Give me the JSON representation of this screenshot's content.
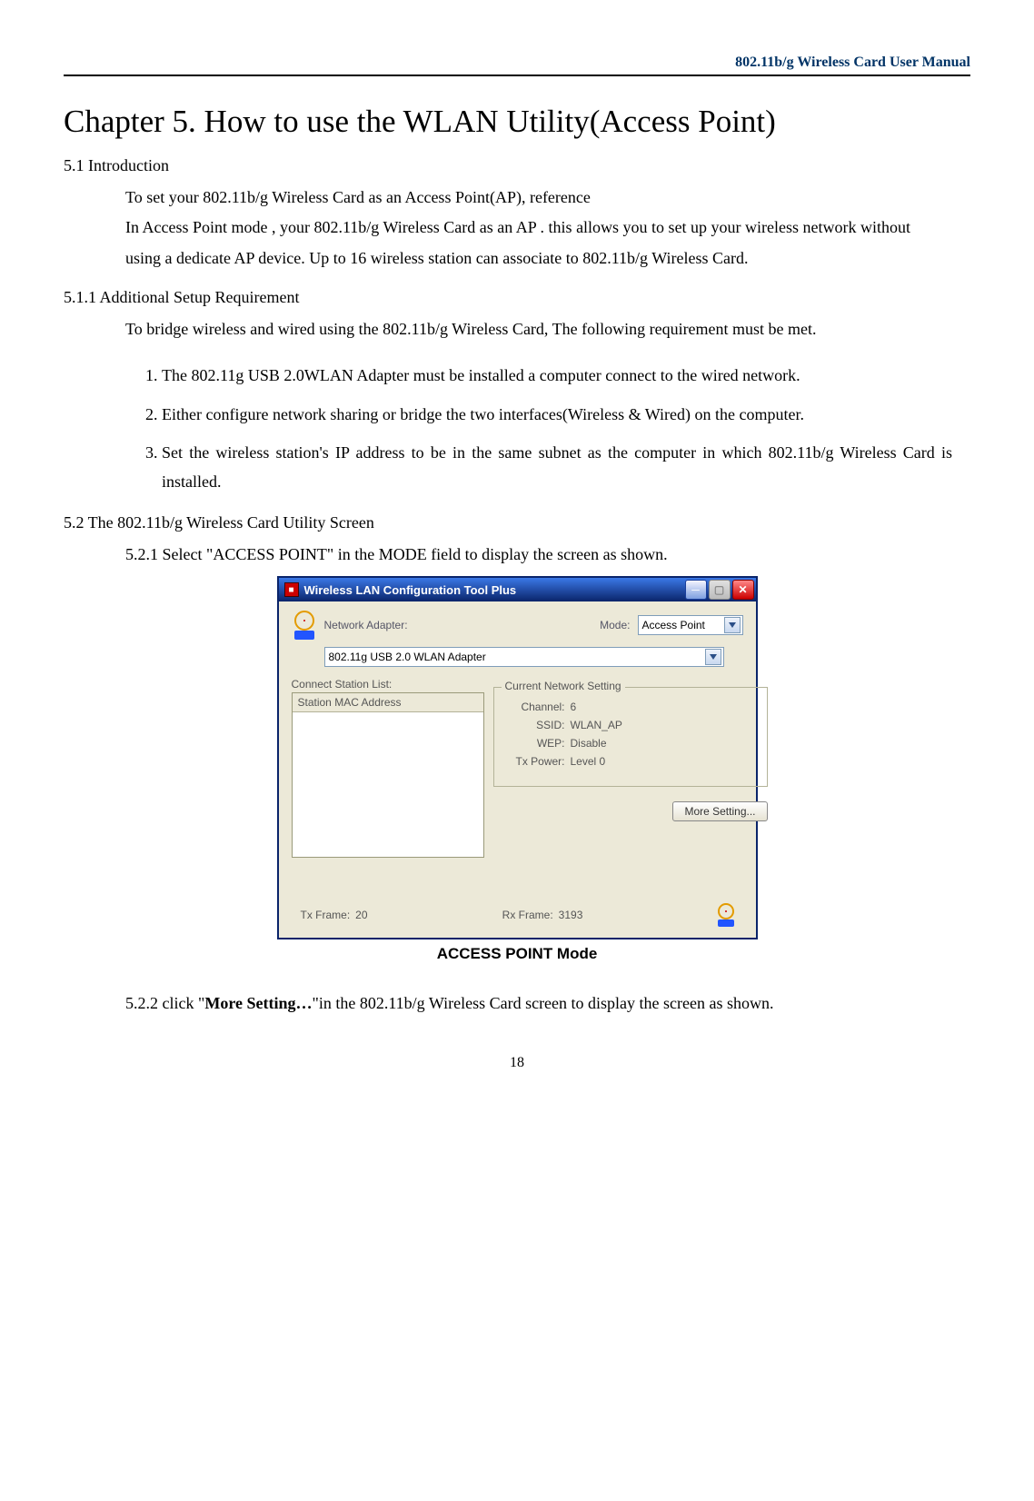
{
  "header": {
    "running_title": "802.11b/g Wireless Card User Manual"
  },
  "chapter": {
    "title": "Chapter 5. How to use the WLAN Utility(Access Point)"
  },
  "sec51": {
    "heading": "5.1 Introduction",
    "p": "To set your 802.11b/g Wireless Card as an Access Point(AP), reference\nIn Access Point mode , your 802.11b/g Wireless Card as an AP . this allows you to set up your wireless network without using a dedicate AP device. Up to 16 wireless station can associate to 802.11b/g Wireless Card."
  },
  "sec511": {
    "heading": "5.1.1 Additional Setup Requirement",
    "p": "To bridge wireless and wired using the 802.11b/g Wireless Card, The following requirement must be met.",
    "items": [
      "The 802.11g USB 2.0WLAN Adapter must be installed a computer connect to the wired network.",
      "Either configure network sharing or bridge the two interfaces(Wireless & Wired) on the computer.",
      "Set the wireless station's IP address to be in the same subnet as the computer in which 802.11b/g Wireless Card is installed."
    ]
  },
  "sec52": {
    "heading": "5.2 The 802.11b/g Wireless Card Utility Screen",
    "s521": "5.2.1 Select \"ACCESS POINT\" in the MODE field to display the screen as shown."
  },
  "window": {
    "title": "Wireless LAN Configuration Tool Plus",
    "network_adapter_label": "Network Adapter:",
    "mode_label": "Mode:",
    "mode_value": "Access Point",
    "adapter_value": "802.11g USB 2.0 WLAN Adapter",
    "connect_station_list_label": "Connect Station List:",
    "station_mac_header": "Station MAC Address",
    "current_setting_title": "Current Network Setting",
    "kv": {
      "channel_k": "Channel:",
      "channel_v": "6",
      "ssid_k": "SSID:",
      "ssid_v": "WLAN_AP",
      "wep_k": "WEP:",
      "wep_v": "Disable",
      "txpower_k": "Tx Power:",
      "txpower_v": "Level 0"
    },
    "more_setting": "More Setting...",
    "tx_frame_label": "Tx Frame:",
    "tx_frame_value": "20",
    "rx_frame_label": "Rx Frame:",
    "rx_frame_value": "3193"
  },
  "fig_caption": "ACCESS POINT Mode",
  "sec522_prefix": "5.2.2 click \"",
  "sec522_bold": "More Setting…",
  "sec522_suffix": "\"in the 802.11b/g Wireless Card screen to display the screen as shown.",
  "page_number": "18"
}
